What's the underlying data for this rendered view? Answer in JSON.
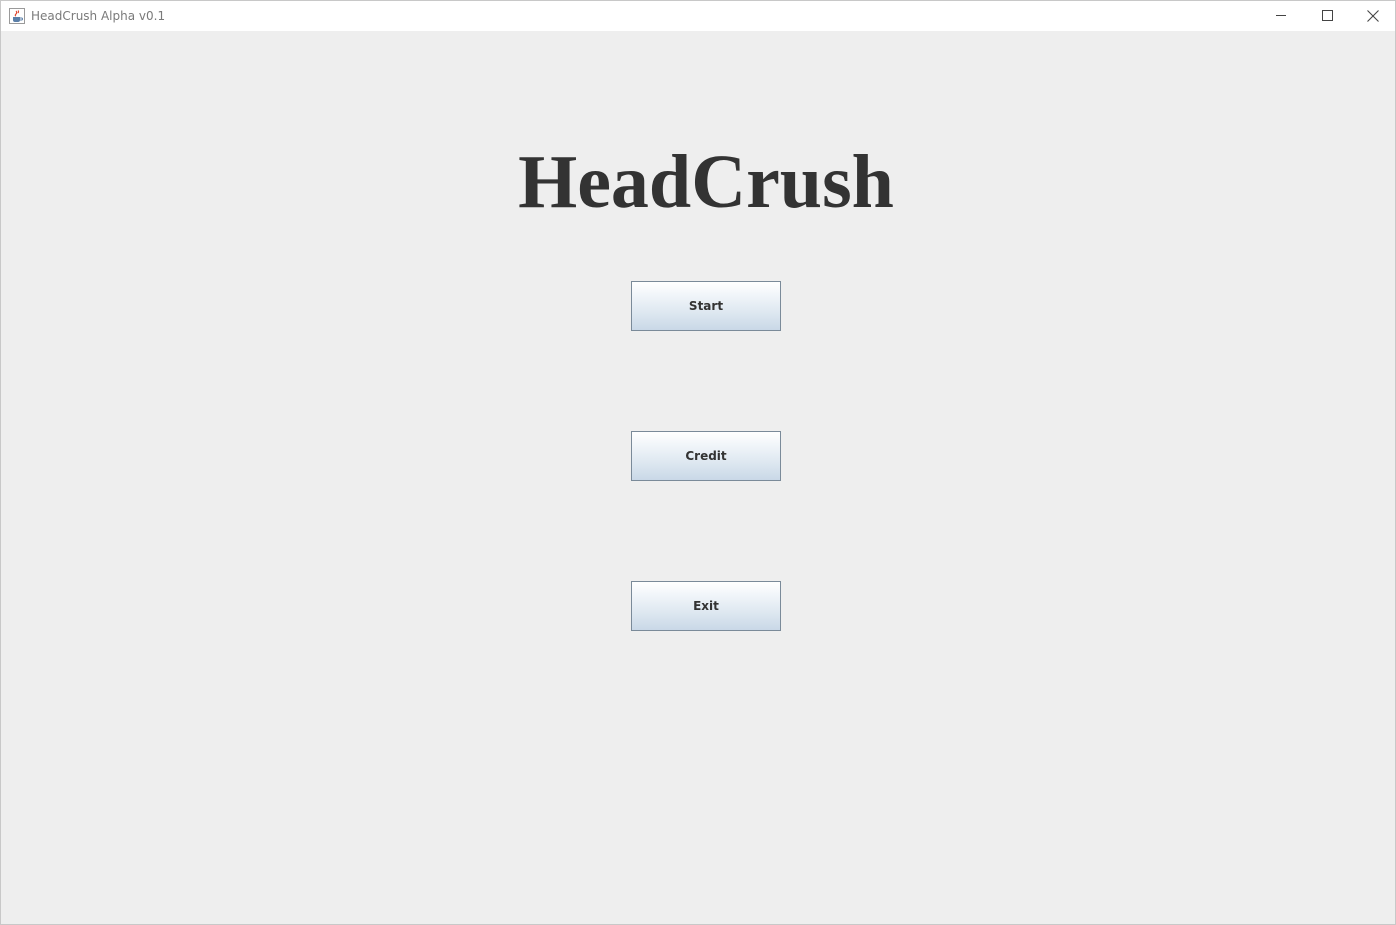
{
  "window": {
    "title": "HeadCrush Alpha v0.1",
    "app_icon": "java-cup-icon",
    "controls": {
      "minimize_icon": "minimize-icon",
      "maximize_icon": "maximize-icon",
      "close_icon": "close-icon"
    }
  },
  "main": {
    "game_title": "HeadCrush",
    "buttons": [
      {
        "label": "Start"
      },
      {
        "label": "Credit"
      },
      {
        "label": "Exit"
      }
    ]
  },
  "colors": {
    "background": "#eeeeee",
    "title_text": "#333333",
    "button_border": "#7a8a99",
    "button_gradient_top": "#ffffff",
    "button_gradient_bottom": "#c9d8e7"
  }
}
